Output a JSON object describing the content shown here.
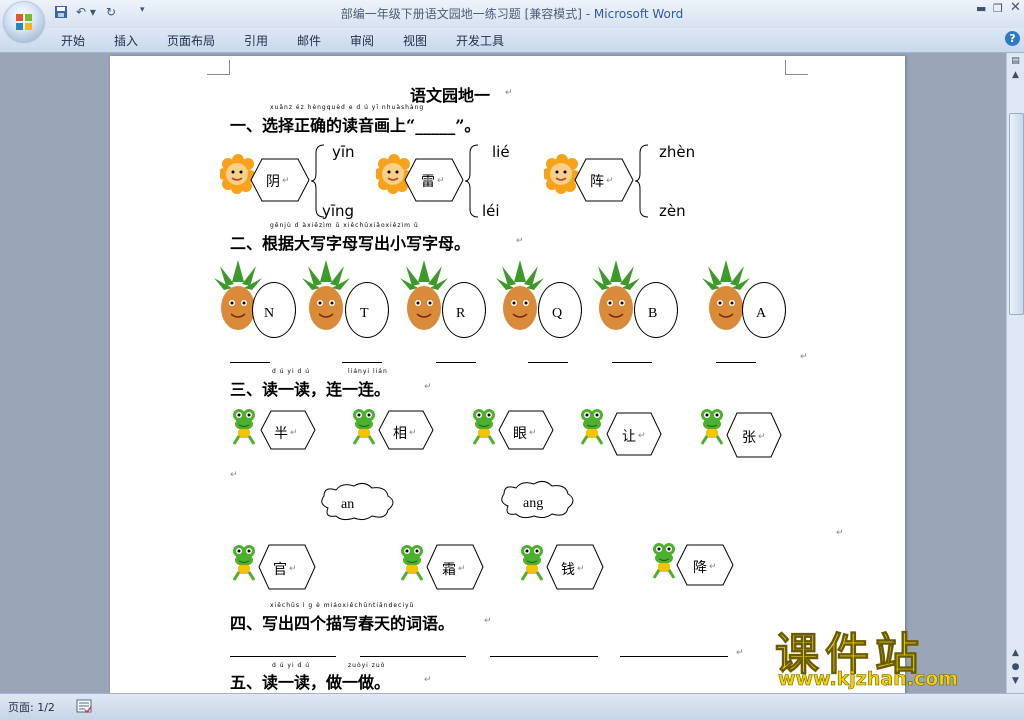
{
  "window": {
    "title": "部编一年级下册语文园地一练习题 [兼容模式] - ",
    "app_name": "Microsoft Word"
  },
  "ribbon_tabs": [
    "开始",
    "插入",
    "页面布局",
    "引用",
    "邮件",
    "审阅",
    "视图",
    "开发工具"
  ],
  "document": {
    "title": "语文园地一",
    "section1": {
      "pinyin": "xuǎnz éz hèngquèd e d ú yī nhuàshàng",
      "heading": "一、选择正确的读音画上“_____”。",
      "items": [
        {
          "char": "阴",
          "top": "yīn",
          "bottom": "yīng"
        },
        {
          "char": "雷",
          "top": "lié",
          "bottom": "léi"
        },
        {
          "char": "阵",
          "top": "zhèn",
          "bottom": "zèn"
        }
      ]
    },
    "section2": {
      "pinyin": "gēnjù d àxiězìm ǔ xiěchūxiǎoxiězìm ǔ",
      "heading": "二、根据大写字母写出小写字母。",
      "letters": [
        "N",
        "T",
        "R",
        "Q",
        "B",
        "A"
      ]
    },
    "section3": {
      "pinyin1": "d ú yi d ú",
      "pinyin2": "liányi lián",
      "heading": "三、读一读，连一连。",
      "row1": [
        "半",
        "相",
        "眼",
        "让",
        "张"
      ],
      "clouds": [
        "an",
        "ang"
      ],
      "row2": [
        "官",
        "霜",
        "钱",
        "降"
      ]
    },
    "section4": {
      "pinyin": "xiěchūs ì g è miáoxiěchūntiāndeciyǔ",
      "heading": "四、写出四个描写春天的词语。"
    },
    "section5": {
      "pinyin1": "d ú yi d ú",
      "pinyin2": "zuòyi zuò",
      "heading": "五、读一读，做一做。"
    }
  },
  "status": {
    "page": "页面: 1/2"
  },
  "watermark": {
    "logo": "课件站",
    "url": "www.kjzhan.com"
  },
  "colors": {
    "title_bar": "#dbe6f4",
    "accent_blue": "#2c5aa8",
    "watermark_yellow": "#f2d500"
  }
}
